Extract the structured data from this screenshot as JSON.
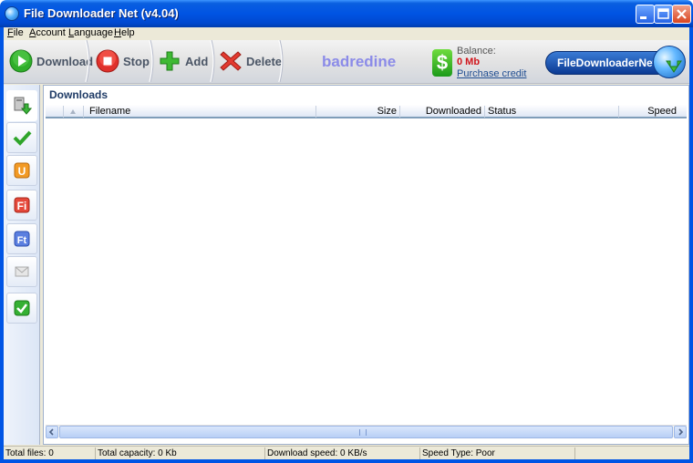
{
  "window": {
    "title": "File Downloader Net (v4.04)"
  },
  "menu": {
    "items": [
      {
        "first": "F",
        "rest": "ile"
      },
      {
        "first": "A",
        "rest": "ccount"
      },
      {
        "first": "L",
        "rest": "anguage"
      },
      {
        "first": "H",
        "rest": "elp"
      }
    ]
  },
  "toolbar": {
    "download_label": "Download",
    "stop_label": "Stop",
    "add_label": "Add",
    "delete_label": "Delete",
    "username": "badredine",
    "balance_label": "Balance:",
    "balance_value": "0 Mb",
    "purchase_label": "Purchase credit",
    "logo_text": "FileDownloaderNet",
    "dollar_symbol": "$"
  },
  "sidebar": {
    "items": [
      {
        "icon": "download-queue-icon"
      },
      {
        "icon": "completed-check-icon"
      },
      {
        "icon": "uploaded-u-icon"
      },
      {
        "icon": "filehost-f-icon"
      },
      {
        "icon": "filehost-ft-icon"
      },
      {
        "icon": "mail-icon"
      },
      {
        "icon": "verified-check-icon"
      }
    ]
  },
  "panel": {
    "title": "Downloads",
    "columns": {
      "filename": "Filename",
      "size": "Size",
      "downloaded": "Downloaded",
      "status": "Status",
      "speed": "Speed"
    }
  },
  "status": {
    "total_files": "Total files: 0",
    "total_capacity": "Total capacity: 0 Kb",
    "download_speed": "Download speed: 0 KB/s",
    "speed_type": "Speed Type: Poor"
  },
  "colors": {
    "titlebar": "#0054e3",
    "username": "#8b8be8",
    "balance_value": "#d0151c",
    "link": "#1f4d91"
  }
}
